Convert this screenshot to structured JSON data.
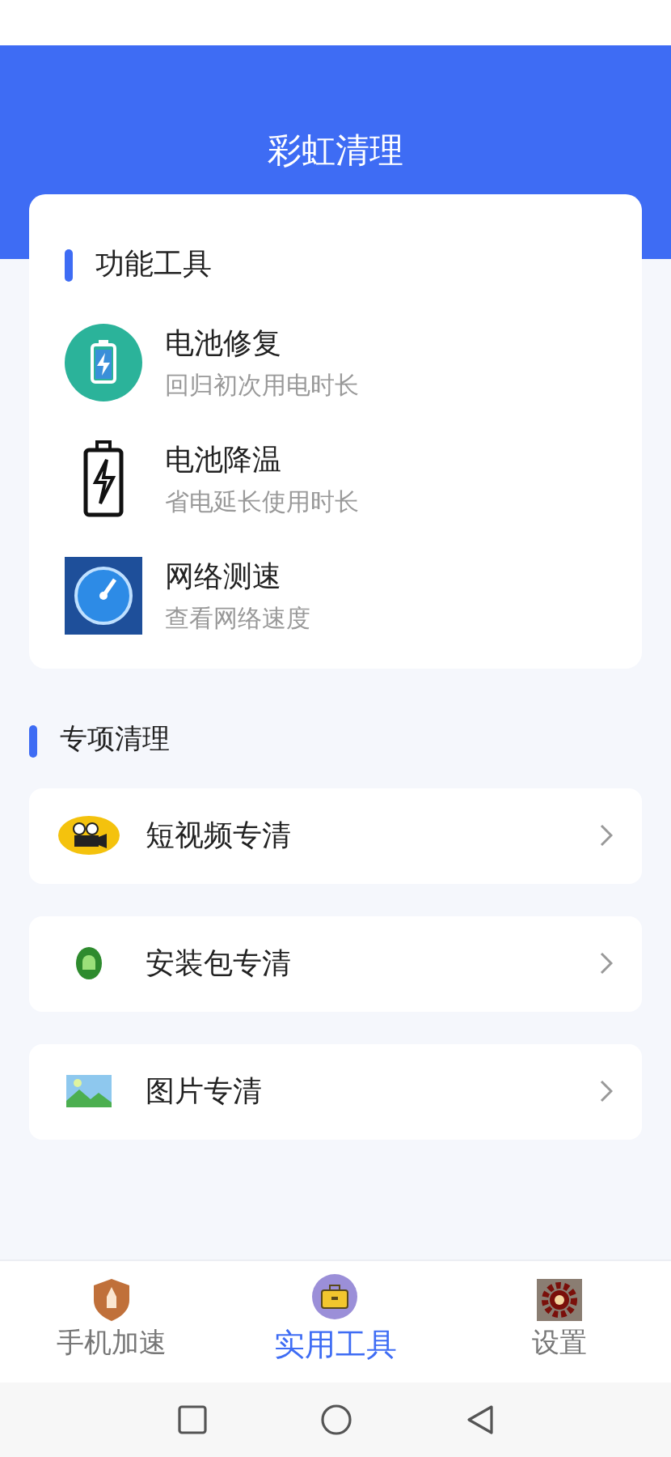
{
  "header": {
    "title": "彩虹清理"
  },
  "tools": {
    "title": "功能工具",
    "items": [
      {
        "kind": "repair",
        "name": "电池修复",
        "desc": "回归初次用电时长"
      },
      {
        "kind": "cool",
        "name": "电池降温",
        "desc": "省电延长使用时长"
      },
      {
        "kind": "speed",
        "name": "网络测速",
        "desc": "查看网络速度"
      }
    ]
  },
  "clean": {
    "title": "专项清理",
    "items": [
      {
        "kind": "video",
        "name": "短视频专清"
      },
      {
        "kind": "apk",
        "name": "安装包专清"
      },
      {
        "kind": "image",
        "name": "图片专清"
      }
    ]
  },
  "nav": [
    {
      "kind": "boost",
      "label": "手机加速",
      "selected": false
    },
    {
      "kind": "tools",
      "label": "实用工具",
      "selected": true
    },
    {
      "kind": "settings",
      "label": "设置",
      "selected": false
    }
  ]
}
